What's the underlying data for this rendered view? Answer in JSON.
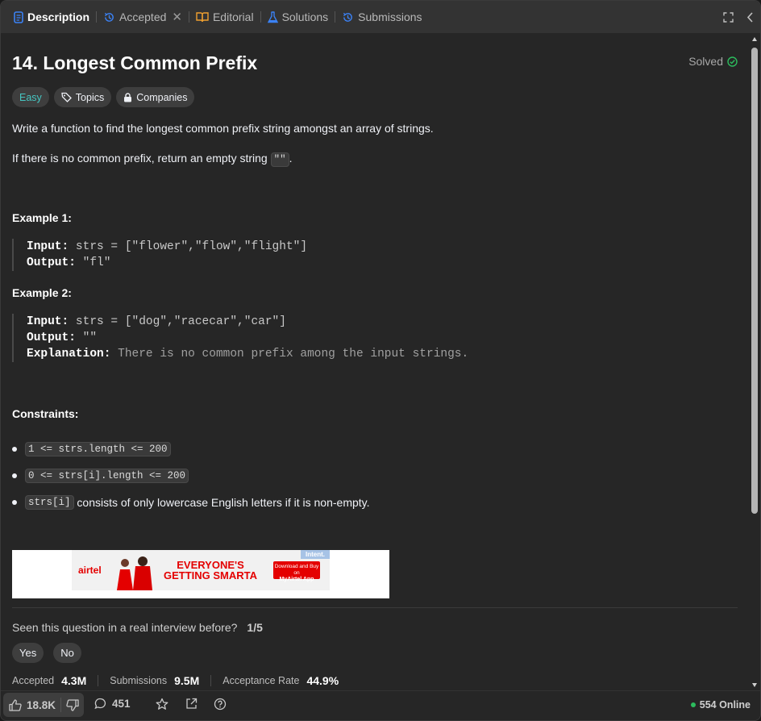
{
  "tabs": [
    {
      "label": "Description",
      "icon": "description-icon",
      "active": true
    },
    {
      "label": "Accepted",
      "icon": "history-icon",
      "closable": true
    },
    {
      "label": "Editorial",
      "icon": "book-icon"
    },
    {
      "label": "Solutions",
      "icon": "flask-icon"
    },
    {
      "label": "Submissions",
      "icon": "history-icon"
    }
  ],
  "problem": {
    "title": "14. Longest Common Prefix",
    "status": "Solved",
    "difficulty": "Easy",
    "topics_label": "Topics",
    "companies_label": "Companies",
    "desc1": "Write a function to find the longest common prefix string amongst an array of strings.",
    "desc2_pre": "If there is no common prefix, return an empty string ",
    "desc2_code": "\"\"",
    "desc2_post": "."
  },
  "examples": [
    {
      "heading": "Example 1:",
      "input_label": "Input:",
      "input": "strs = [\"flower\",\"flow\",\"flight\"]",
      "output_label": "Output:",
      "output": "\"fl\""
    },
    {
      "heading": "Example 2:",
      "input_label": "Input:",
      "input": "strs = [\"dog\",\"racecar\",\"car\"]",
      "output_label": "Output:",
      "output": "\"\"",
      "explanation_label": "Explanation:",
      "explanation": "There is no common prefix among the input strings."
    }
  ],
  "constraints": {
    "heading": "Constraints:",
    "items": [
      {
        "code": "1 <= strs.length <= 200",
        "text": ""
      },
      {
        "code": "0 <= strs[i].length <= 200",
        "text": ""
      },
      {
        "code": "strs[i]",
        "text": " consists of only lowercase English letters if it is non-empty."
      }
    ]
  },
  "ad": {
    "brand": "airtel",
    "headline_1": "EVERYONE'S",
    "headline_2": "GETTING SMARTA",
    "cta_small": "Download and Buy on",
    "cta": "MyAirtel App",
    "intent": "Intent."
  },
  "interview": {
    "question": "Seen this question in a real interview before?",
    "progress": "1/5",
    "yes": "Yes",
    "no": "No"
  },
  "stats": {
    "accepted_label": "Accepted",
    "accepted": "4.3M",
    "submissions_label": "Submissions",
    "submissions": "9.5M",
    "rate_label": "Acceptance Rate",
    "rate": "44.9%"
  },
  "footer": {
    "likes": "18.8K",
    "comments": "451",
    "online": "554 Online"
  },
  "colors": {
    "easy": "#46c6c2",
    "solved": "#2cbb5d",
    "accent_blue": "#3b82f6",
    "editorial_orange": "#f0a030"
  }
}
